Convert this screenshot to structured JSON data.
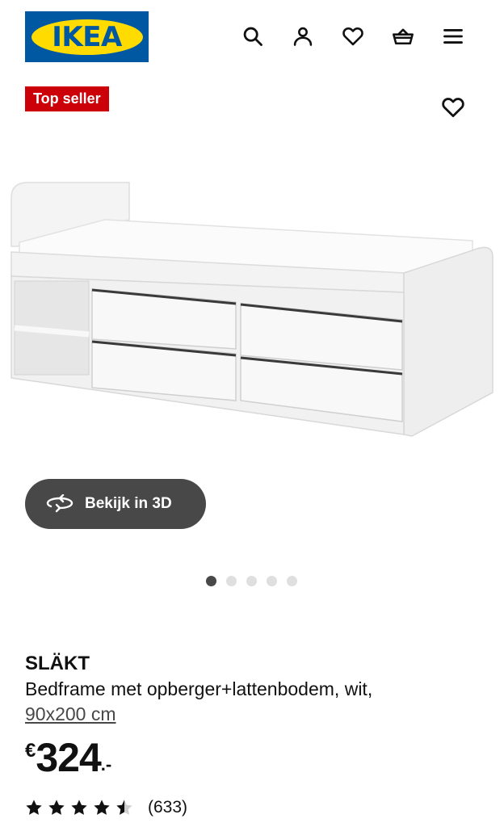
{
  "header": {
    "logo_text": "IKEA",
    "icons": [
      "search-icon",
      "user-icon",
      "heart-icon",
      "basket-icon",
      "menu-icon"
    ]
  },
  "badge": {
    "label": "Top seller",
    "color": "#cc0008"
  },
  "product": {
    "name": "SLÄKT",
    "description": "Bedframe met opberger+lattenbodem, wit,",
    "size": "90x200 cm",
    "price": {
      "currency": "€",
      "amount": "324",
      "decimals": ".-"
    },
    "rating": {
      "value": 4.5,
      "max": 5,
      "count_text": "(633)"
    }
  },
  "view3d": {
    "label": "Bekijk in 3D"
  },
  "carousel": {
    "total": 5,
    "active_index": 0
  },
  "colors": {
    "brand_blue": "#0058a3",
    "brand_yellow": "#ffdb00",
    "dark_button": "#484848"
  }
}
